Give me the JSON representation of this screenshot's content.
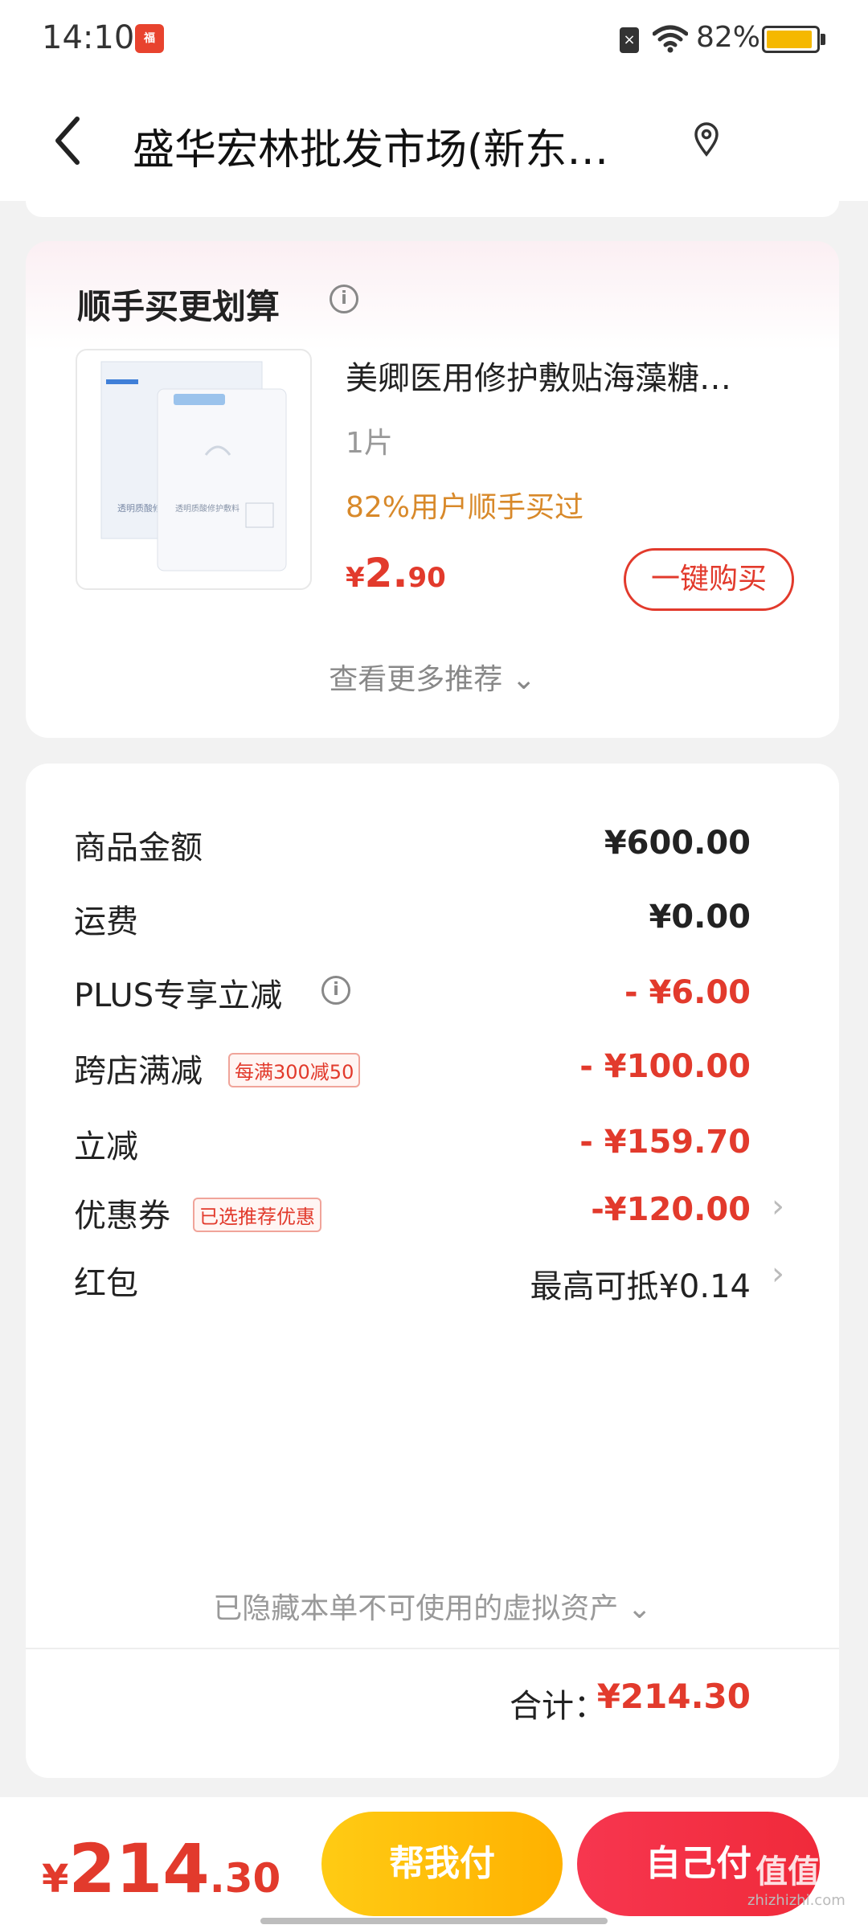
{
  "status_bar": {
    "time": "14:10",
    "app_badge": "福",
    "battery": "82%"
  },
  "header": {
    "title": "盛华宏林批发市场(新东…"
  },
  "recommend": {
    "title": "顺手买更划算",
    "product": {
      "name": "美卿医用修护敷贴海藻糖…",
      "spec": "1片",
      "social": "82%用户顺手买过",
      "price_symbol": "¥",
      "price_int": "2.",
      "price_dec": "90"
    },
    "buy_label": "一键购买",
    "see_more": "查看更多推荐 ⌄"
  },
  "summary": {
    "rows": [
      {
        "label": "商品金额",
        "value": "¥600.00"
      },
      {
        "label": "运费",
        "value": "¥0.00"
      },
      {
        "label": "PLUS专享立减",
        "value": "- ¥6.00"
      },
      {
        "label": "跨店满减",
        "tag": "每满300减50",
        "value": "- ¥100.00"
      },
      {
        "label": "立减",
        "value": "- ¥159.70"
      },
      {
        "label": "优惠券",
        "tag": "已选推荐优惠",
        "value": "-¥120.00"
      },
      {
        "label": "红包",
        "value": "最高可抵¥0.14"
      }
    ],
    "hidden_assets": "已隐藏本单不可使用的虚拟资产 ⌄",
    "total_label": "合计：",
    "total_value": "¥214.30"
  },
  "bottom": {
    "price_symbol": "¥",
    "price_int": "214",
    "price_dec": ".30",
    "help_pay": "帮我付",
    "self_pay": "自己付",
    "watermark": "值值值",
    "watermark_sub": "zhizhizhi.com"
  },
  "colors": {
    "accent_red": "#e23a2c",
    "yellow_button": "#ffb100",
    "red_button": "#f02a3a",
    "social_orange": "#d8892a"
  }
}
